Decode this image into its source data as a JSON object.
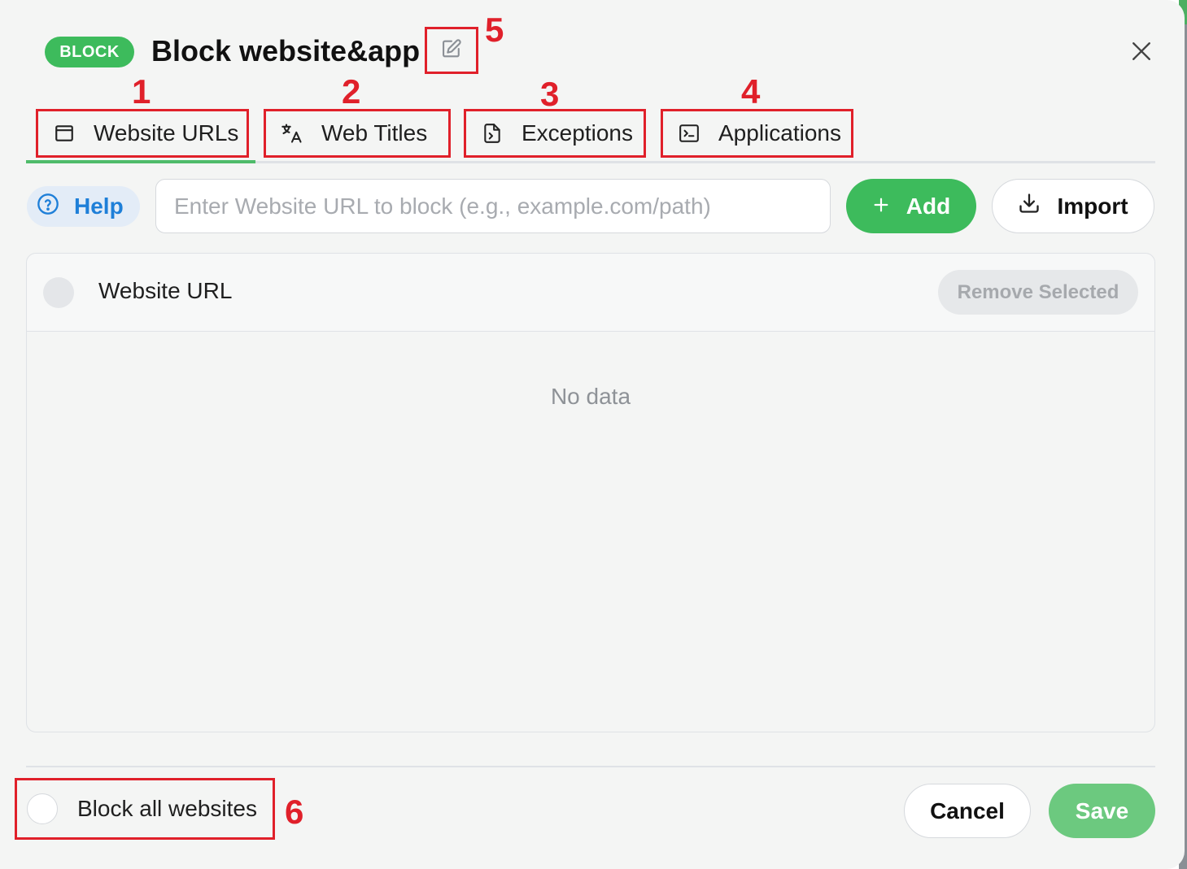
{
  "header": {
    "badge": "BLOCK",
    "title": "Block website&app"
  },
  "tabs": [
    {
      "label": "Website URLs",
      "icon": "browser-window-icon",
      "active": true
    },
    {
      "label": "Web Titles",
      "icon": "translate-icon",
      "active": false
    },
    {
      "label": "Exceptions",
      "icon": "file-export-icon",
      "active": false
    },
    {
      "label": "Applications",
      "icon": "terminal-icon",
      "active": false
    }
  ],
  "annotations": [
    "1",
    "2",
    "3",
    "4",
    "5",
    "6"
  ],
  "toolbar": {
    "help_label": "Help",
    "url_placeholder": "Enter Website URL to block (e.g., example.com/path)",
    "url_value": "",
    "add_label": "Add",
    "import_label": "Import"
  },
  "table": {
    "column_header": "Website URL",
    "remove_selected_label": "Remove Selected",
    "empty_text": "No data",
    "rows": []
  },
  "footer": {
    "block_all_label": "Block all websites",
    "block_all_checked": false,
    "cancel_label": "Cancel",
    "save_label": "Save"
  },
  "colors": {
    "accent_green": "#3dbb5c",
    "save_green": "#6cc97f",
    "help_blue": "#1e7fd8",
    "annotation_red": "#e0202a"
  }
}
